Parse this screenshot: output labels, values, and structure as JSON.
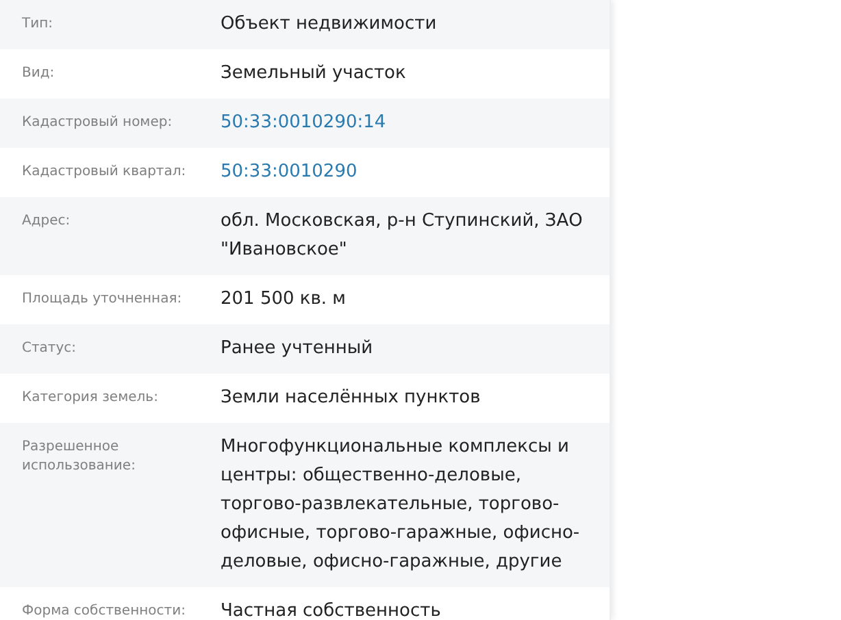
{
  "properties": [
    {
      "label": "Тип:",
      "value": "Объект недвижимости",
      "kind": "text"
    },
    {
      "label": "Вид:",
      "value": "Земельный участок",
      "kind": "text"
    },
    {
      "label": "Кадастровый номер:",
      "value": "50:33:0010290:14",
      "kind": "link"
    },
    {
      "label": "Кадастровый квартал:",
      "value": "50:33:0010290",
      "kind": "link"
    },
    {
      "label": "Адрес:",
      "value": "обл. Московская, р-н Ступинский, ЗАО \"Ивановское\"",
      "kind": "text"
    },
    {
      "label": "Площадь уточненная:",
      "value": "201 500 кв. м",
      "kind": "text"
    },
    {
      "label": "Статус:",
      "value": "Ранее учтенный",
      "kind": "text"
    },
    {
      "label": "Категория земель:",
      "value": "Земли населённых пунктов",
      "kind": "text"
    },
    {
      "label": "Разрешенное использование:",
      "value": "Многофункциональные комплексы и центры: общественно-деловые, торгово-развлекательные, торгово-офисные, торгово-гаражные, офисно-деловые, офисно-гаражные, другие",
      "kind": "text"
    },
    {
      "label": "Форма собственности:",
      "value": "Частная собственность",
      "kind": "text"
    }
  ]
}
